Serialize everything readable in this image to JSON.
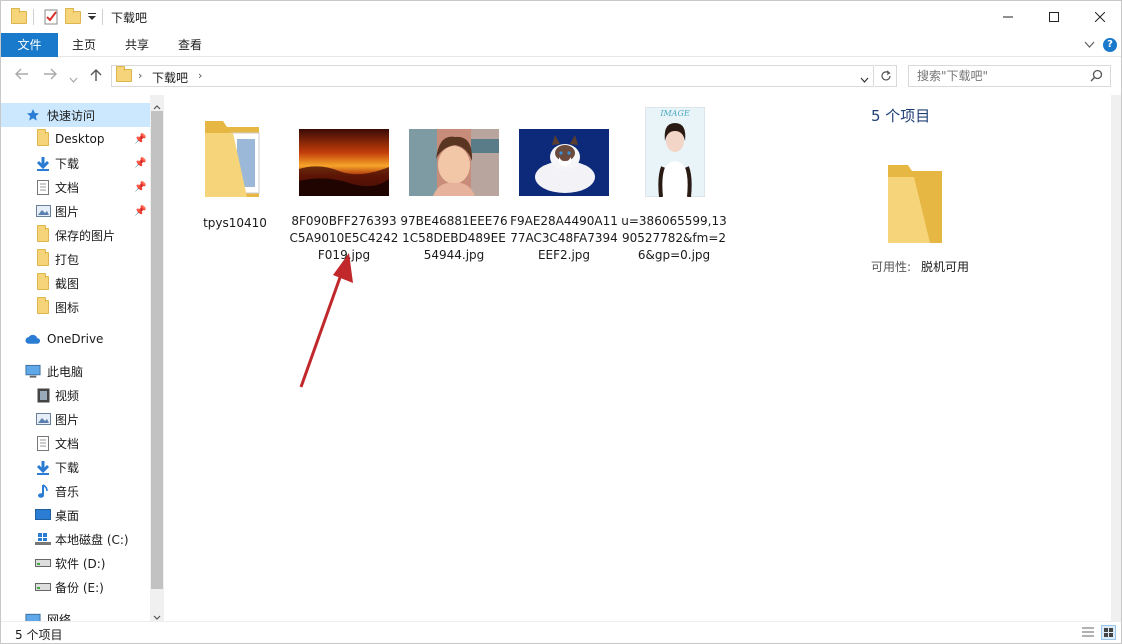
{
  "window": {
    "title": "下载吧",
    "controls": {
      "minimize": "—",
      "maximize": "☐",
      "close": "✕"
    }
  },
  "ribbon": {
    "tabs": [
      "文件",
      "主页",
      "共享",
      "查看"
    ]
  },
  "addressbar": {
    "path": [
      "下载吧"
    ],
    "search_placeholder": "搜索\"下载吧\""
  },
  "nav": {
    "quick_access": "快速访问",
    "quick_items": [
      "Desktop",
      "下载",
      "文档",
      "图片",
      "保存的图片",
      "打包",
      "截图",
      "图标"
    ],
    "onedrive": "OneDrive",
    "this_pc": "此电脑",
    "pc_items": [
      "视频",
      "图片",
      "文档",
      "下载",
      "音乐",
      "桌面",
      "本地磁盘 (C:)",
      "软件 (D:)",
      "备份 (E:)"
    ],
    "network": "网络"
  },
  "files": [
    {
      "name": "tpys10410",
      "kind": "folder"
    },
    {
      "name": "8F090BFF276393C5A9010E5C4242F019.jpg",
      "kind": "sunset"
    },
    {
      "name": "97BE46881EEE761C58DEBD489EE54944.jpg",
      "kind": "anime"
    },
    {
      "name": "F9AE28A4490A1177AC3C48FA7394EEF2.jpg",
      "kind": "cat"
    },
    {
      "name": "u=386065599,1390527782&fm=26&gp=0.jpg",
      "kind": "portrait"
    }
  ],
  "details": {
    "count": "5 个项目",
    "availability_label": "可用性:",
    "availability_value": "脱机可用"
  },
  "status": {
    "count": "5 个项目"
  },
  "colors": {
    "accent": "#1979ca",
    "selection": "#cce8ff",
    "folder": "#f5d47a",
    "arrow": "#c0282b"
  }
}
